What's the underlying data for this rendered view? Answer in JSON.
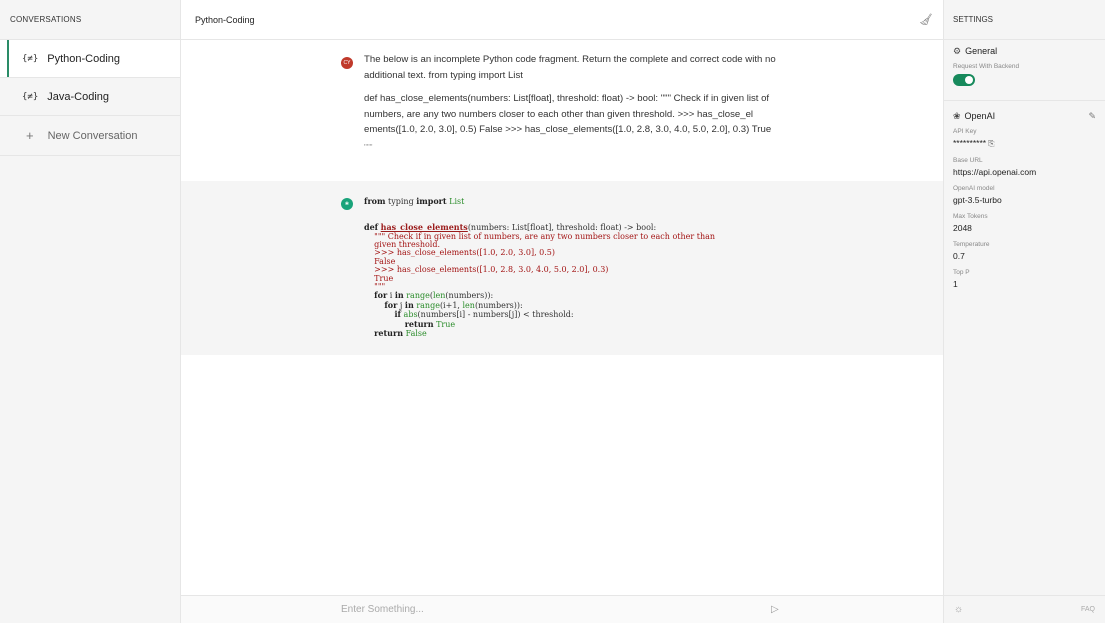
{
  "sidebar": {
    "header": "CONVERSATIONS",
    "conversations": [
      {
        "icon": "{≠}",
        "label": "Python-Coding"
      },
      {
        "icon": "{≠}",
        "label": "Java-Coding"
      }
    ],
    "new_conversation": "New Conversation"
  },
  "main": {
    "title": "Python-Coding",
    "user_message": {
      "p1": "The below is an incomplete Python code fragment. Return the complete and correct code with no additional text. from typing import List",
      "p2": "def has_close_elements(numbers: List[float], threshold: float) -> bool: \"\"\" Check if in given list of numbers, are any two numbers closer to each other than given threshold. >>> has_close_el ements([1.0, 2.0, 3.0], 0.5) False >>> has_close_elements([1.0, 2.8, 3.0, 4.0, 5.0, 2.0], 0.3) True",
      "p3": "\"\"\""
    },
    "input_placeholder": "Enter Something..."
  },
  "settings": {
    "header": "SETTINGS",
    "general": {
      "title": "General",
      "request_label": "Request With Backend",
      "request_enabled": true
    },
    "openai": {
      "title": "OpenAI",
      "api_key_label": "API Key",
      "api_key_value": "**********",
      "base_url_label": "Base URL",
      "base_url_value": "https://api.openai.com",
      "model_label": "OpenAI model",
      "model_value": "gpt-3.5-turbo",
      "max_tokens_label": "Max Tokens",
      "max_tokens_value": "2048",
      "temperature_label": "Temperature",
      "temperature_value": "0.7",
      "top_p_label": "Top P",
      "top_p_value": "1"
    },
    "faq": "FAQ"
  },
  "colors": {
    "accent": "#178a5c",
    "user_avatar": "#c0392b",
    "bot_avatar": "#19a37a"
  }
}
